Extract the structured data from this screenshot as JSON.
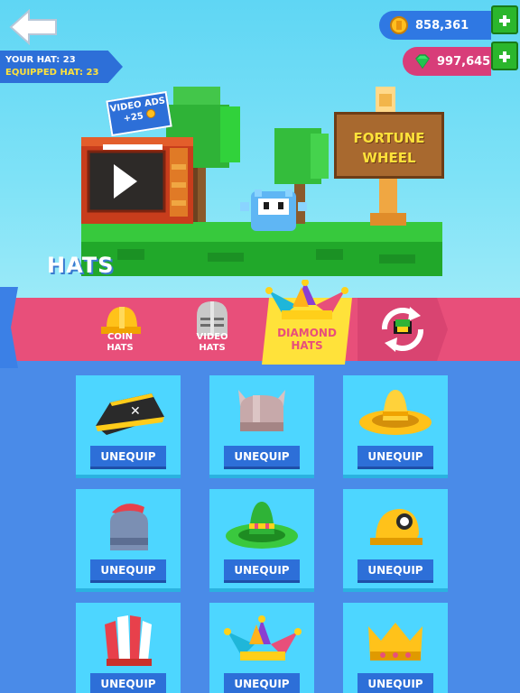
{
  "header": {
    "your_hat": "YOUR HAT: 23",
    "equipped_hat": "EQUIPPED HAT: 23",
    "coins": "858,361",
    "gems": "997,645"
  },
  "scene": {
    "video_ads_label": "VIDEO ADS",
    "video_ads_reward": "+25",
    "fortune_line1": "FORTUNE",
    "fortune_line2": "WHEEL",
    "section_title": "HATS"
  },
  "tabs": [
    {
      "label": "COIN\nHATS",
      "icon": "hard-hat-icon"
    },
    {
      "label": "VIDEO\nHATS",
      "icon": "knight-helmet-icon"
    },
    {
      "label": "DIAMOND\nHATS",
      "icon": "jester-hat-icon",
      "selected": true
    },
    {
      "label": "",
      "icon": "random-refresh-icon"
    }
  ],
  "hats": [
    {
      "name": "pirate-hat",
      "button": "UNEQUIP"
    },
    {
      "name": "horned-helmet",
      "button": "UNEQUIP"
    },
    {
      "name": "sombrero-yellow",
      "button": "UNEQUIP"
    },
    {
      "name": "roman-helmet",
      "button": "UNEQUIP"
    },
    {
      "name": "sombrero-green",
      "button": "UNEQUIP"
    },
    {
      "name": "miner-hat",
      "button": "UNEQUIP"
    },
    {
      "name": "feather-headdress",
      "button": "UNEQUIP"
    },
    {
      "name": "jester-hat",
      "button": "UNEQUIP"
    },
    {
      "name": "crown",
      "button": "UNEQUIP"
    }
  ],
  "colors": {
    "sky": "#7ee2f7",
    "panel": "#4a8be8",
    "tab_band": "#e84f7a",
    "tab_selected": "#ffe23a",
    "card": "#4dd6ff",
    "button": "#2d6fd8"
  }
}
